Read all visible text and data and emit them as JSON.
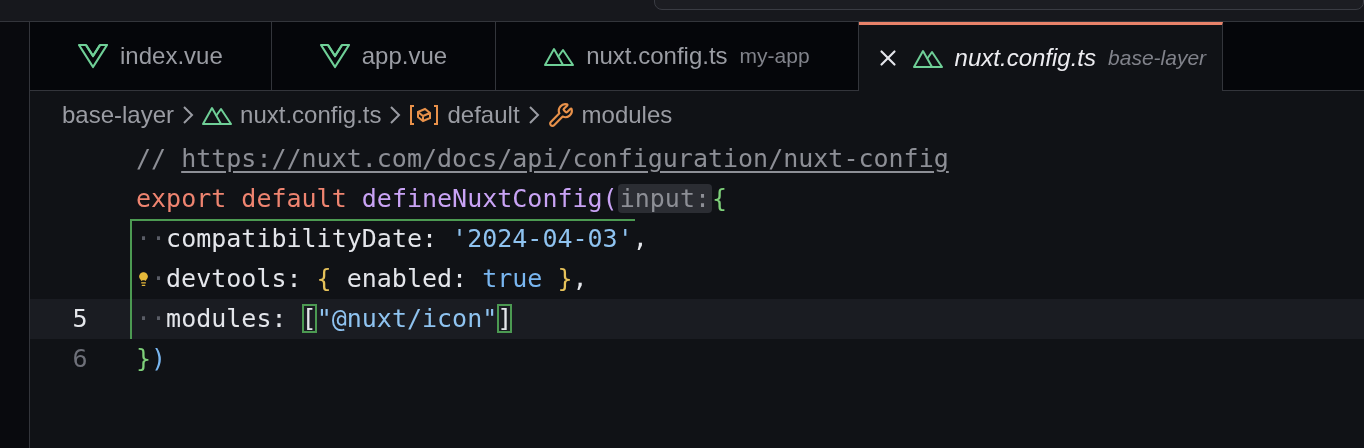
{
  "tabs": [
    {
      "label": "index.vue",
      "kind": "vue",
      "selected": false,
      "preview": false
    },
    {
      "label": "app.vue",
      "kind": "vue",
      "selected": false,
      "preview": false
    },
    {
      "label": "nuxt.config.ts",
      "description": "my-app",
      "kind": "nuxt",
      "selected": false,
      "preview": false
    },
    {
      "label": "nuxt.config.ts",
      "description": "base-layer",
      "kind": "nuxt",
      "selected": true,
      "preview": true
    }
  ],
  "breadcrumb": [
    {
      "label": "base-layer",
      "kind": "folder"
    },
    {
      "label": "nuxt.config.ts",
      "kind": "file"
    },
    {
      "label": "default",
      "kind": "module"
    },
    {
      "label": "modules",
      "kind": "property"
    }
  ],
  "lines": [
    {
      "current": false,
      "lightbulb": false,
      "scope": false,
      "tokens": [
        {
          "kind": "comment",
          "text": "// "
        },
        {
          "kind": "link",
          "text": "https://nuxt.com/docs/api/configuration/nuxt-config"
        }
      ]
    },
    {
      "current": false,
      "lightbulb": false,
      "scope": false,
      "tokens": [
        {
          "kind": "keyword",
          "text": "export default "
        },
        {
          "kind": "function",
          "text": "defineNuxtConfig"
        },
        {
          "kind": "paren",
          "text": "("
        },
        {
          "kind": "hint",
          "text": "input:"
        },
        {
          "kind": "brace",
          "text": "{"
        }
      ]
    },
    {
      "current": false,
      "lightbulb": false,
      "scope": true,
      "tokens": [
        {
          "kind": "whitespace",
          "text": "··"
        },
        {
          "kind": "plain",
          "text": "compatibilityDate: "
        },
        {
          "kind": "string",
          "text": "'2024-04-03'"
        },
        {
          "kind": "plain",
          "text": ","
        }
      ]
    },
    {
      "current": false,
      "lightbulb": true,
      "scope": true,
      "tokens": [
        {
          "kind": "whitespace",
          "text": "·"
        },
        {
          "kind": "plain",
          "text": "devtools: "
        },
        {
          "kind": "object",
          "text": "{"
        },
        {
          "kind": "plain",
          "text": " enabled: "
        },
        {
          "kind": "bool",
          "text": "true"
        },
        {
          "kind": "object",
          "text": " }"
        },
        {
          "kind": "plain",
          "text": ","
        }
      ]
    },
    {
      "number": "5",
      "current": true,
      "lightbulb": false,
      "scope": true,
      "tokens": [
        {
          "kind": "whitespace",
          "text": "··"
        },
        {
          "kind": "plain",
          "text": "modules: "
        },
        {
          "kind": "match",
          "text": "["
        },
        {
          "kind": "string",
          "text": "\"@nuxt/icon\""
        },
        {
          "kind": "match",
          "text": "]"
        }
      ]
    },
    {
      "number": "6",
      "current": false,
      "lightbulb": false,
      "scope": false,
      "tokens": [
        {
          "kind": "brace",
          "text": "}"
        },
        {
          "kind": "paren2",
          "text": ")"
        }
      ]
    }
  ]
}
